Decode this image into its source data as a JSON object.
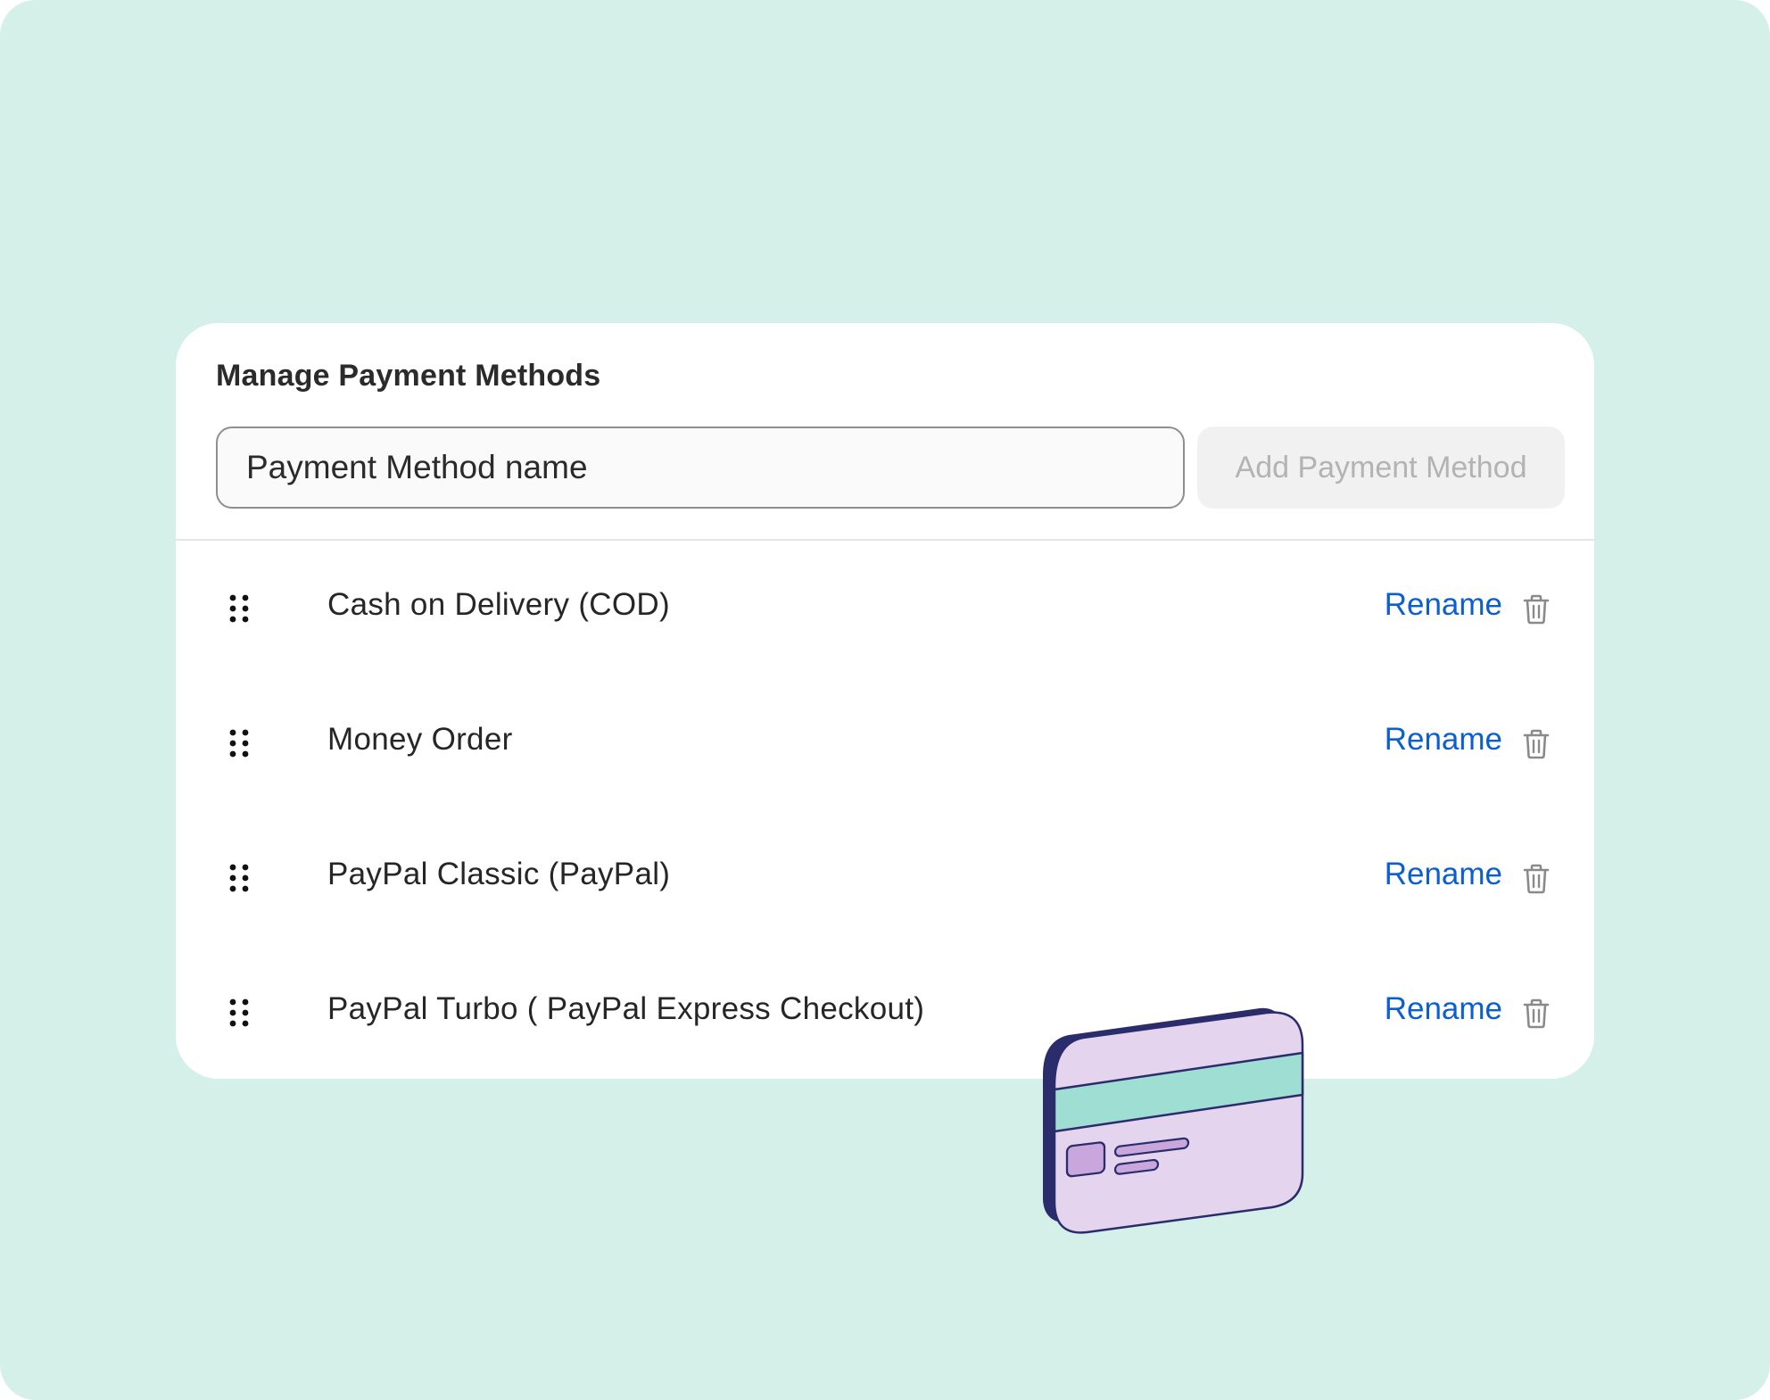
{
  "panel": {
    "title": "Manage Payment Methods",
    "input": {
      "placeholder": "Payment Method name",
      "value": ""
    },
    "add_button_label": "Add Payment Method"
  },
  "methods": [
    {
      "label": "Cash on Delivery (COD)",
      "rename_label": "Rename"
    },
    {
      "label": "Money Order",
      "rename_label": "Rename"
    },
    {
      "label": "PayPal Classic (PayPal)",
      "rename_label": "Rename"
    },
    {
      "label": "PayPal Turbo ( PayPal Express Checkout)",
      "rename_label": "Rename"
    }
  ],
  "icons": {
    "drag": "drag-handle-icon",
    "delete": "trash-icon",
    "illustration": "credit-card-icon"
  },
  "colors": {
    "background": "#d5efe9",
    "panel": "#ffffff",
    "link": "#0b5fd1",
    "button_disabled_bg": "#f1f1f1",
    "button_disabled_text": "#b3b3b3",
    "card_body": "#e5d4ee",
    "card_stripe": "#9fded3",
    "card_outline": "#2a2c6b"
  }
}
